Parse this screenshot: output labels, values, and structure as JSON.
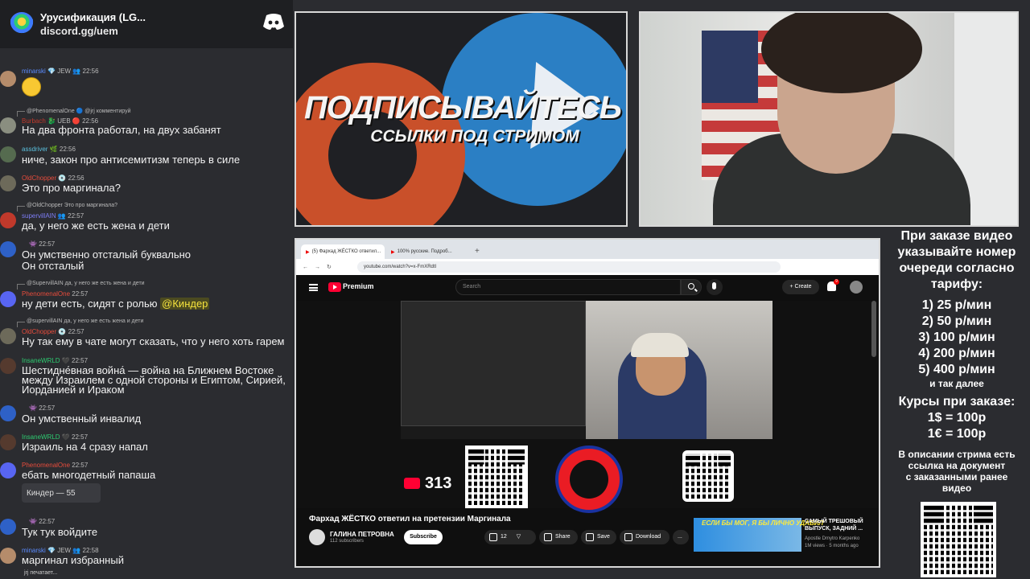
{
  "server": {
    "name": "Урусификация (LG...",
    "invite": "discord.gg/uem"
  },
  "chat": [
    {
      "nick": "minarski",
      "badges": "💎 JEW 👥",
      "time": "22:56",
      "text": "",
      "color": "#5b8cff"
    },
    {
      "reply": "@PhenomenalOne 🔵 @jrj комментируй",
      "nick": "Burbach",
      "badges": "🐉 UEB 🔴",
      "time": "22:56",
      "text": "На два фронта работал, на двух забанят",
      "color": "#c0392b"
    },
    {
      "nick": "assdriver",
      "badges": "🌿",
      "time": "22:56",
      "text": "ниче, закон про антисемитизм теперь в силе",
      "color": "#5bc0de"
    },
    {
      "nick": "OldChopper",
      "badges": "💿",
      "time": "22:56",
      "text": "Это про маргинала?",
      "color": "#e74c3c"
    },
    {
      "reply": "@OldChopper Это про маргинала?",
      "nick": "supervillAIN",
      "badges": "👥",
      "time": "22:57",
      "text": "да, у него же есть жена и дети",
      "color": "#7d7df5"
    },
    {
      "nick": "",
      "badges": "👾",
      "time": "22:57",
      "text": "Он умственно отсталый буквально",
      "text2": "Он отсталый",
      "color": "#d5d5d5"
    },
    {
      "reply": "@SupervillAIN да, у него же есть жена и дети",
      "nick": "PhenomenalOne",
      "badges": "",
      "time": "22:57",
      "text": "ну дети есть, сидят с ролью ",
      "mention": "@Киндер",
      "color": "#e74c3c"
    },
    {
      "reply": "@supervillAIN да, у него же есть жена и дети",
      "nick": "OldChopper",
      "badges": "💿",
      "time": "22:57",
      "text": "Ну так ему в чате могут сказать, что у него хоть гарем",
      "color": "#e74c3c"
    },
    {
      "nick": "InsaneWRLD",
      "badges": "🖤",
      "time": "22:57",
      "text": "Шестидне́вная война́ — война на Ближнем Востоке",
      "text2": "между Израилем с одной стороны и Египтом, Сирией,",
      "text3": "Иорданией и Ираком",
      "color": "#2ecc71"
    },
    {
      "nick": "",
      "badges": "👾",
      "time": "22:57",
      "text": "Он умственный инвалид",
      "color": "#d5d5d5"
    },
    {
      "nick": "InsaneWRLD",
      "badges": "🖤",
      "time": "22:57",
      "text": "Израиль на 4 сразу напал",
      "color": "#2ecc71"
    },
    {
      "nick": "PhenomenalOne",
      "badges": "",
      "time": "22:57",
      "text": "ебать многодетный папаша",
      "react": "Киндер — 55",
      "color": "#e74c3c"
    },
    {
      "nick": "",
      "badges": "👾",
      "time": "22:57",
      "text": "Тук тук войдите",
      "color": "#d5d5d5"
    },
    {
      "nick": "minarski",
      "badges": "💎 JEW 👥",
      "time": "22:58",
      "text": "маргинал избранный",
      "color": "#5b8cff"
    }
  ],
  "typing": "jrj печатает...",
  "promo": {
    "line1": "ПОДПИСЫВАЙТЕСЬ",
    "line2": "ССЫЛКИ ПОД СТРИМОМ"
  },
  "price": {
    "intro": [
      "При заказе видео",
      "указывайте номер",
      "очереди согласно",
      "тарифу:"
    ],
    "tiers": [
      "1) 25 р/мин",
      "2) 50 р/мин",
      "3) 100 р/мин",
      "4) 200 р/мин",
      "5) 400 р/мин"
    ],
    "etc": "и так далее",
    "rates_title": "Курсы при заказе:",
    "rates": [
      "1$ = 100р",
      "1€ = 100р"
    ],
    "desc": [
      "В описании стрима есть",
      "ссылка на документ",
      "с заказанными ранее",
      "видео"
    ]
  },
  "browser": {
    "tabs": [
      "(5) Фархад ЖЁСТКО ответил...",
      "100% русские. Подроб..."
    ],
    "url": "youtube.com/watch?v=x-FmXRdtI",
    "yt_brand": "Premium",
    "search_placeholder": "Search",
    "create": "+ Create",
    "notif": "9"
  },
  "video": {
    "title": "Фархад ЖЁСТКО ответил на претензии Маргинала",
    "channel": "ГАЛИНА ПЕТРОВНА",
    "subs": "112 subscribers",
    "subscribe": "Subscribe",
    "likes": "12",
    "share": "Share",
    "save": "Save",
    "download": "Download",
    "more": "...",
    "promo_count": "313"
  },
  "rec": {
    "thumb_text": "ЕСЛИ БЫ МОГ, Я БЫ ЛИЧНО УДАВИЛ",
    "title": "САМЫЙ ТРЕШОВЫЙ ВЫПУСК, ЗАДНИЙ ...",
    "channel": "Apostle Dmytro Karpenko",
    "meta": "1M views · 5 months ago"
  },
  "colors": {
    "bg": "#2b2c30",
    "yt_red": "#ff0033",
    "mention_bg": "#4b4a20",
    "mention_fg": "#f5e23d"
  }
}
